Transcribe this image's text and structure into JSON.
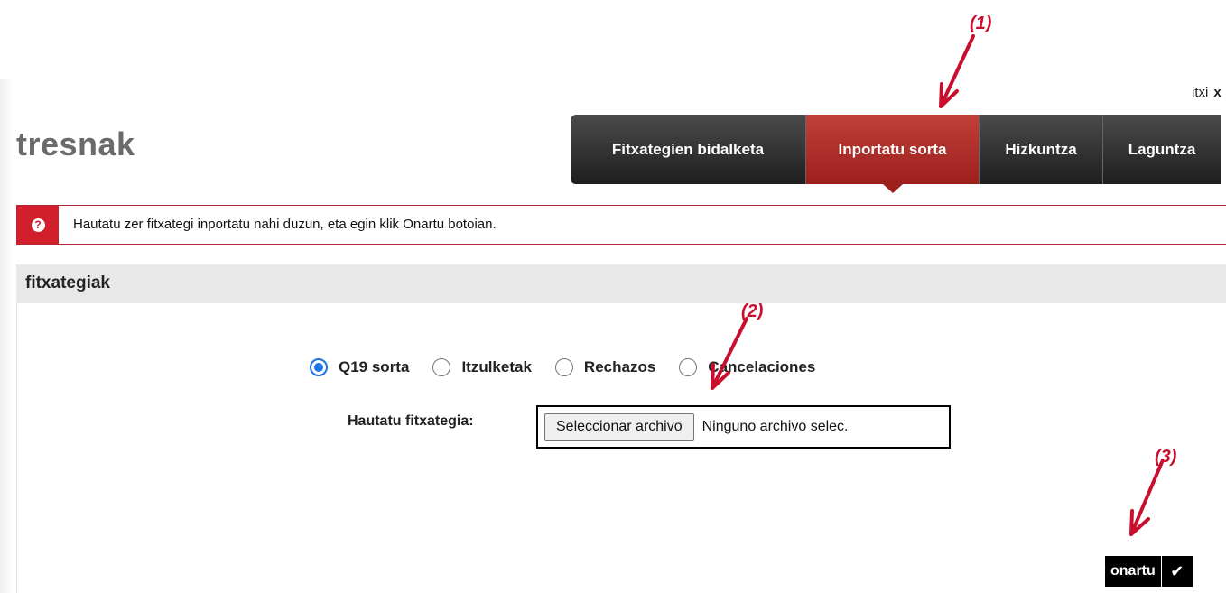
{
  "header": {
    "title": "tresnak",
    "close_label": "itxi",
    "close_symbol": "x"
  },
  "tabs": [
    {
      "label": "Fitxategien bidalketa",
      "active": false
    },
    {
      "label": "Inportatu sorta",
      "active": true
    },
    {
      "label": "Hizkuntza",
      "active": false
    },
    {
      "label": "Laguntza",
      "active": false
    }
  ],
  "alert": {
    "icon": "question-icon",
    "icon_glyph": "?",
    "text": "Hautatu zer fitxategi inportatu nahi duzun, eta egin klik Onartu botoian."
  },
  "section": {
    "title": "fitxategiak",
    "radios": [
      {
        "label": "Q19 sorta",
        "checked": true
      },
      {
        "label": "Itzulketak",
        "checked": false
      },
      {
        "label": "Rechazos",
        "checked": false
      },
      {
        "label": "Cancelaciones",
        "checked": false
      }
    ],
    "file_label": "Hautatu fitxategia:",
    "file_button_label": "Seleccionar archivo",
    "file_status": "Ninguno archivo selec."
  },
  "actions": {
    "submit_label": "onartu",
    "submit_icon": "checkmark-icon",
    "submit_glyph": "✔"
  },
  "annotations": {
    "one": "(1)",
    "two": "(2)",
    "three": "(3)",
    "color": "#c8102e"
  },
  "colors": {
    "active_tab": "#b32e2a",
    "tab": "#2d2d2d",
    "alert_red": "#d11f2c",
    "radio_blue": "#1a73e8",
    "section_bg": "#e8e8e8"
  }
}
